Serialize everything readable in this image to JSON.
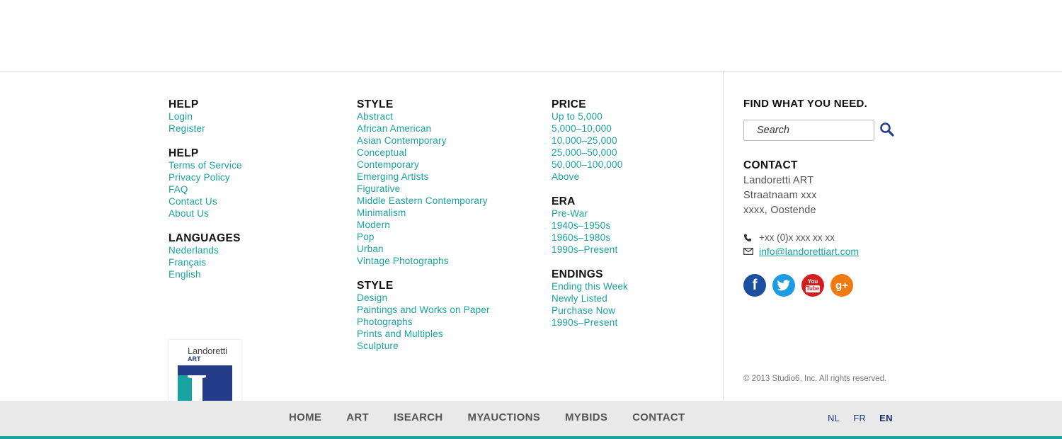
{
  "columns": [
    [
      {
        "title": "HELP",
        "links": [
          "Login",
          "Register"
        ]
      },
      {
        "title": "HELP",
        "links": [
          "Terms of Service",
          "Privacy Policy",
          "FAQ",
          "Contact Us",
          "About Us"
        ]
      },
      {
        "title": "LANGUAGES",
        "links": [
          "Nederlands",
          "Français",
          "English"
        ]
      }
    ],
    [
      {
        "title": "STYLE",
        "links": [
          "Abstract",
          "African American",
          "Asian Contemporary",
          "Conceptual",
          "Contemporary",
          "Emerging Artists",
          "Figurative",
          "Middle Eastern Contemporary",
          "Minimalism",
          "Modern",
          "Pop",
          "Urban",
          "Vintage Photographs"
        ]
      },
      {
        "title": "STYLE",
        "links": [
          "Design",
          "Paintings and Works on Paper",
          "Photographs",
          "Prints and Multiples",
          "Sculpture"
        ]
      }
    ],
    [
      {
        "title": "PRICE",
        "links": [
          "Up to 5,000",
          "5,000–10,000",
          "10,000–25,000",
          "25,000–50,000",
          "50,000–100,000",
          "Above"
        ]
      },
      {
        "title": "ERA",
        "links": [
          "Pre-War",
          "1940s–1950s",
          "1960s–1980s",
          "1990s–Present"
        ]
      },
      {
        "title": "ENDINGS",
        "links": [
          "Ending this Week",
          "Newly Listed",
          "Purchase Now",
          "1990s–Present"
        ]
      }
    ]
  ],
  "search": {
    "title": "FIND WHAT YOU NEED.",
    "placeholder": "Search",
    "icon": "search-icon"
  },
  "contact": {
    "title": "CONTACT",
    "address": [
      "Landoretti ART",
      "Straatnaam xxx",
      "xxxx, Oostende"
    ],
    "phone": "+xx (0)x xxx xx xx",
    "email": "info@landorettiart.com"
  },
  "socials": [
    {
      "name": "facebook",
      "glyph": "f"
    },
    {
      "name": "twitter",
      "glyph": ""
    },
    {
      "name": "youtube",
      "glyph_top": "You",
      "glyph_bottom": "Tube"
    },
    {
      "name": "google-plus",
      "glyph": "g+"
    }
  ],
  "copyright": "© 2013 Studio6, Inc. All rights reserved.",
  "logo": {
    "name": "Landoretti",
    "sub": "ART"
  },
  "nav": [
    "HOME",
    "ART",
    "ISEARCH",
    "MYAUCTIONS",
    "MYBIDS",
    "CONTACT"
  ],
  "languages": {
    "items": [
      "NL",
      "FR",
      "EN"
    ],
    "active": "EN"
  },
  "colors": {
    "accent": "#18a3a0",
    "navy": "#233d8a",
    "nav_bg": "#e9e9e9"
  }
}
